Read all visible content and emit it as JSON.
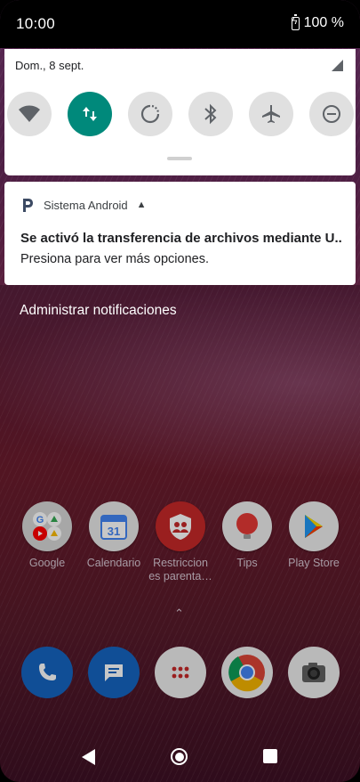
{
  "status_bar": {
    "time": "10:00",
    "battery": "100 %"
  },
  "quick_settings": {
    "date": "Dom., 8 sept.",
    "tiles": [
      {
        "name": "wifi",
        "icon": "wifi-icon",
        "active": false
      },
      {
        "name": "mobile-data",
        "icon": "data-transfer-icon",
        "active": true
      },
      {
        "name": "auto-rotate",
        "icon": "rotate-icon",
        "active": false
      },
      {
        "name": "bluetooth",
        "icon": "bluetooth-icon",
        "active": false
      },
      {
        "name": "airplane",
        "icon": "airplane-icon",
        "active": false
      },
      {
        "name": "do-not-disturb",
        "icon": "dnd-icon",
        "active": false
      }
    ],
    "accent": "#00897b"
  },
  "notification": {
    "app_name": "Sistema Android",
    "title": "Se activó la transferencia de archivos mediante U..",
    "text": "Presiona para ver más opciones."
  },
  "manage_label": "Administrar notificaciones",
  "home_apps": [
    {
      "label": "Google",
      "icon": "google-folder-icon"
    },
    {
      "label": "Calendario",
      "icon": "calendar-icon",
      "badge": "31"
    },
    {
      "label": "Restriccion es parenta…",
      "icon": "parental-controls-icon"
    },
    {
      "label": "Tips",
      "icon": "tips-icon"
    },
    {
      "label": "Play Store",
      "icon": "play-store-icon"
    }
  ],
  "dock": [
    {
      "name": "phone",
      "icon": "phone-icon"
    },
    {
      "name": "messages",
      "icon": "messages-icon"
    },
    {
      "name": "app-drawer",
      "icon": "apps-grid-icon"
    },
    {
      "name": "chrome",
      "icon": "chrome-icon"
    },
    {
      "name": "camera",
      "icon": "camera-icon"
    }
  ]
}
